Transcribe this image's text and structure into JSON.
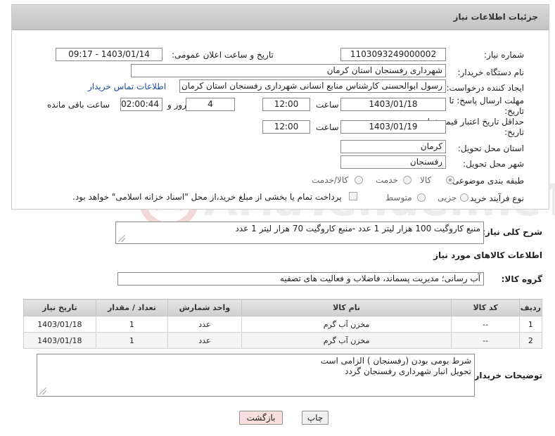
{
  "header": {
    "title": "جزئیات اطلاعات نیاز"
  },
  "form": {
    "need_number_label": "شماره نیاز:",
    "need_number": "1103093249000002",
    "announce_label": "تاریخ و ساعت اعلان عمومی:",
    "announce_value": "1403/01/14 - 09:17",
    "buyer_org_label": "نام دستگاه خریدار:",
    "buyer_org": "شهرداری رفسنجان استان کرمان",
    "creator_label": "ایجاد کننده درخواست:",
    "creator": "رسول ابوالحسنی کارشناس منابع انسانی شهرداری رفسنجان استان کرمان",
    "contact_link": "اطلاعات تماس خریدار",
    "deadline_label_1": "مهلت ارسال پاسخ: تا",
    "deadline_label_2": "تاریخ:",
    "deadline_date": "1403/01/18",
    "time_label": "ساعت",
    "deadline_time": "12:00",
    "days_value": "4",
    "days_label": "روز و",
    "remaining_time": "02:00:44",
    "remaining_label": "ساعت باقی مانده",
    "validity_label_1": "حداقل تاریخ اعتبار قیمت: تا",
    "validity_label_2": "تاریخ:",
    "validity_date": "1403/01/19",
    "validity_time": "12:00",
    "province_label": "استان محل تحویل:",
    "province": "کرمان",
    "city_label": "شهر محل تحویل:",
    "city": "رفسنجان",
    "category_label": "طبقه بندی موضوعی:",
    "category_options": [
      "کالا",
      "خدمت",
      "کالا/خدمت"
    ],
    "category_selected": "کالا",
    "process_label": "نوع فرآیند خرید :",
    "process_options": [
      "جزیی",
      "متوسط"
    ],
    "payment_note": "پرداخت تمام یا بخشی از مبلغ خرید،از محل \"اسناد خزانه اسلامی\" خواهد بود."
  },
  "description": {
    "label": "شرح کلی نیاز:",
    "value": "منبع کاروگیت 100 هزار لیتر 1 عدد -منبع کاروگیت 70 هزار لیتر 1 عدد"
  },
  "goods_section": {
    "title": "اطلاعات کالاهای مورد نیاز",
    "group_label": "گروه کالا:",
    "group_value": "آب رسانی؛ مدیریت پسماند، فاضلاب و فعالیت های تصفیه"
  },
  "table": {
    "headers": [
      "ردیف",
      "کد کالا",
      "نام کالا",
      "واحد شمارش",
      "تعداد / مقدار",
      "تاریخ نیاز"
    ],
    "rows": [
      [
        "1",
        "--",
        "مخزن آب گرم",
        "عدد",
        "1",
        "1403/01/18"
      ],
      [
        "2",
        "--",
        "مخزن آب گرم",
        "عدد",
        "1",
        "1403/01/18"
      ]
    ]
  },
  "buyer_notes": {
    "label": "توضیحات خریدار:",
    "line1": "شرط بومی بودن (رفسنجان ) الزامی است",
    "line2": "تحویل انبار شهرداری رفسنجان گردد"
  },
  "buttons": {
    "print": "چاپ",
    "back": "بازگشت"
  },
  "watermark": {
    "text": "AriaTender.neT"
  },
  "colors": {
    "header_bg": "#c8c8c8",
    "link": "#1a4fa0",
    "back_btn_bg": "#f8dede",
    "print_btn_bg": "#f0f0f0"
  }
}
